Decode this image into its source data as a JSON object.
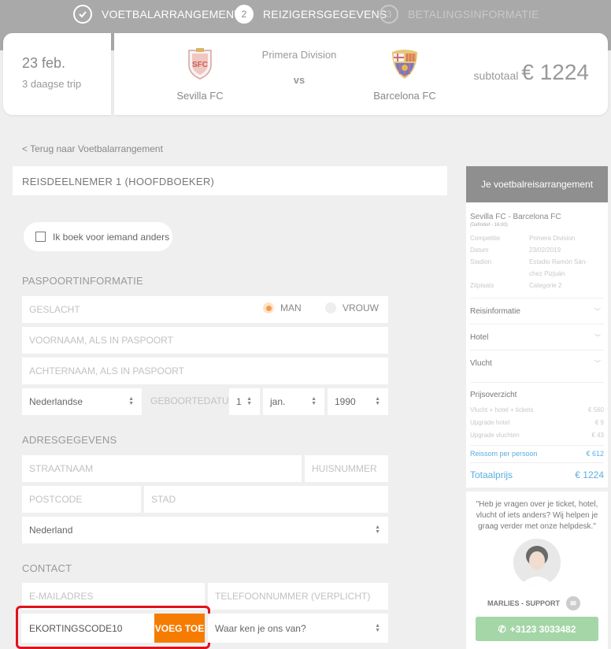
{
  "steps": [
    {
      "num": "✓",
      "label": "VOETBALARRANGEMENT"
    },
    {
      "num": "2",
      "label": "REIZIGERSGEGEVENS"
    },
    {
      "num": "3",
      "label": "BETALINGSINFORMATIE"
    }
  ],
  "match": {
    "date": "23 feb.",
    "trip": "3 daagse trip",
    "league": "Primera Division",
    "vs": "vs",
    "home": "Sevilla FC",
    "away": "Barcelona FC",
    "subtotal_label": "subtotaal",
    "subtotal_amount": "€ 1224"
  },
  "back_link": "< Terug naar Voetbalarrangement",
  "traveler_title": "REISDEELNEMER 1 (HOOFDBOEKER)",
  "booking_for_other": "Ik boek voor iemand anders",
  "passport": {
    "title": "PASPOORTINFORMATIE",
    "gender_label": "GESLACHT",
    "male": "MAN",
    "female": "VROUW",
    "firstname_ph": "VOORNAAM, ALS IN PASPOORT",
    "lastname_ph": "ACHTERNAAM, ALS IN PASPOORT",
    "nationality": "Nederlandse",
    "birthdate_label": "GEBOORTEDATUM",
    "day": "1",
    "month": "jan.",
    "year": "1990"
  },
  "address": {
    "title": "ADRESGEGEVENS",
    "street_ph": "STRAATNAAM",
    "house_ph": "HUISNUMMER",
    "postcode_ph": "POSTCODE",
    "city_ph": "STAD",
    "country": "Nederland"
  },
  "contact": {
    "title": "CONTACT",
    "email_ph": "E-MAILADRES",
    "phone_ph": "TELEFOONNUMMER (VERPLICHT)",
    "discount_value": "EKORTINGSCODE10",
    "add_button": "VOEG TOE",
    "source_select": "Waar ken je ons van?"
  },
  "sidebar": {
    "title": "Je voetbalreisarrangement",
    "match": "Sevilla FC - Barcelona FC",
    "definitive": "(Definitief - 16:00)",
    "rows": [
      {
        "k": "Competitie",
        "v": "Primera Division"
      },
      {
        "k": "Datum",
        "v": "23/02/2019"
      },
      {
        "k": "Stadion",
        "v": "Estadio Ramón Sán-"
      },
      {
        "k": "",
        "v": "chez Pizjuán"
      },
      {
        "k": "Zitplaats",
        "v": "Categorie 2"
      }
    ],
    "acc_travel": "Reisinformatie",
    "acc_hotel": "Hotel",
    "acc_flight": "Vlucht",
    "price_title": "Prijsoverzicht",
    "prices": [
      {
        "k": "Vlucht + hotel + tickets",
        "v": "€ 560"
      },
      {
        "k": "Upgrade hotel",
        "v": "€ 9"
      },
      {
        "k": "Upgrade vluchten",
        "v": "€ 43"
      }
    ],
    "per_person_label": "Reissom per persoon",
    "per_person_value": "€ 612",
    "total_label": "Totaalprijs",
    "total_value": "€ 1224"
  },
  "support": {
    "quote": "\"Heb je vragen over je ticket, hotel, vlucht of iets anders? Wij helpen je graag verder met onze helpdesk.\"",
    "name": "MARLIES - SUPPORT",
    "phone": "+3123 3033482"
  }
}
